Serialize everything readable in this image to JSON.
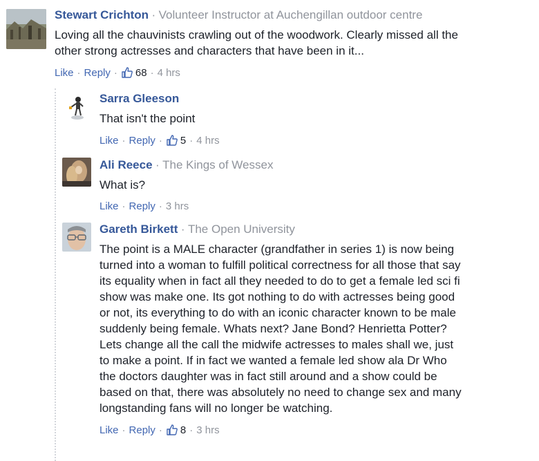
{
  "comments": [
    {
      "name": "Stewart Crichton",
      "separator": "·",
      "affiliation": "Volunteer Instructor at Auchengillan outdoor centre",
      "text": "Loving all the chauvinists crawling out of the woodwork. Clearly missed all the other strong actresses and characters that have been in it...",
      "like_label": "Like",
      "reply_label": "Reply",
      "dot": "·",
      "likes": "68",
      "time": "4 hrs"
    }
  ],
  "replies": [
    {
      "name": "Sarra Gleeson",
      "text": "That isn't the point",
      "like_label": "Like",
      "reply_label": "Reply",
      "dot": "·",
      "likes": "5",
      "time": "4 hrs"
    },
    {
      "name": "Ali Reece",
      "separator": "·",
      "affiliation": "The Kings of Wessex",
      "text": "What is?",
      "like_label": "Like",
      "reply_label": "Reply",
      "dot": "·",
      "time": "3 hrs"
    },
    {
      "name": "Gareth Birkett",
      "separator": "·",
      "affiliation": "The Open University",
      "text": "The point is a MALE character (grandfather in series 1) is now being turned into a woman to fulfill political correctness for all those that say its equality when in fact all they needed to do to get a female led sci fi show was make one. Its got nothing to do with actresses being good or not, its everything to do with an iconic character known to be male suddenly being female. Whats next? Jane Bond? Henrietta Potter? Lets change all the call the midwife actresses to males shall we, just to make a point. If in fact we wanted a female led show ala Dr Who the doctors daughter was in fact still around and a show could be based on that, there was absolutely no need to change sex and many longstanding fans will no longer be watching.",
      "like_label": "Like",
      "reply_label": "Reply",
      "dot": "·",
      "likes": "8",
      "time": "3 hrs"
    }
  ],
  "colors": {
    "name": "#365899",
    "link": "#4267b2",
    "meta": "#90949c",
    "text": "#1d2129"
  },
  "icons": {
    "like": "thumbs-up-icon"
  }
}
